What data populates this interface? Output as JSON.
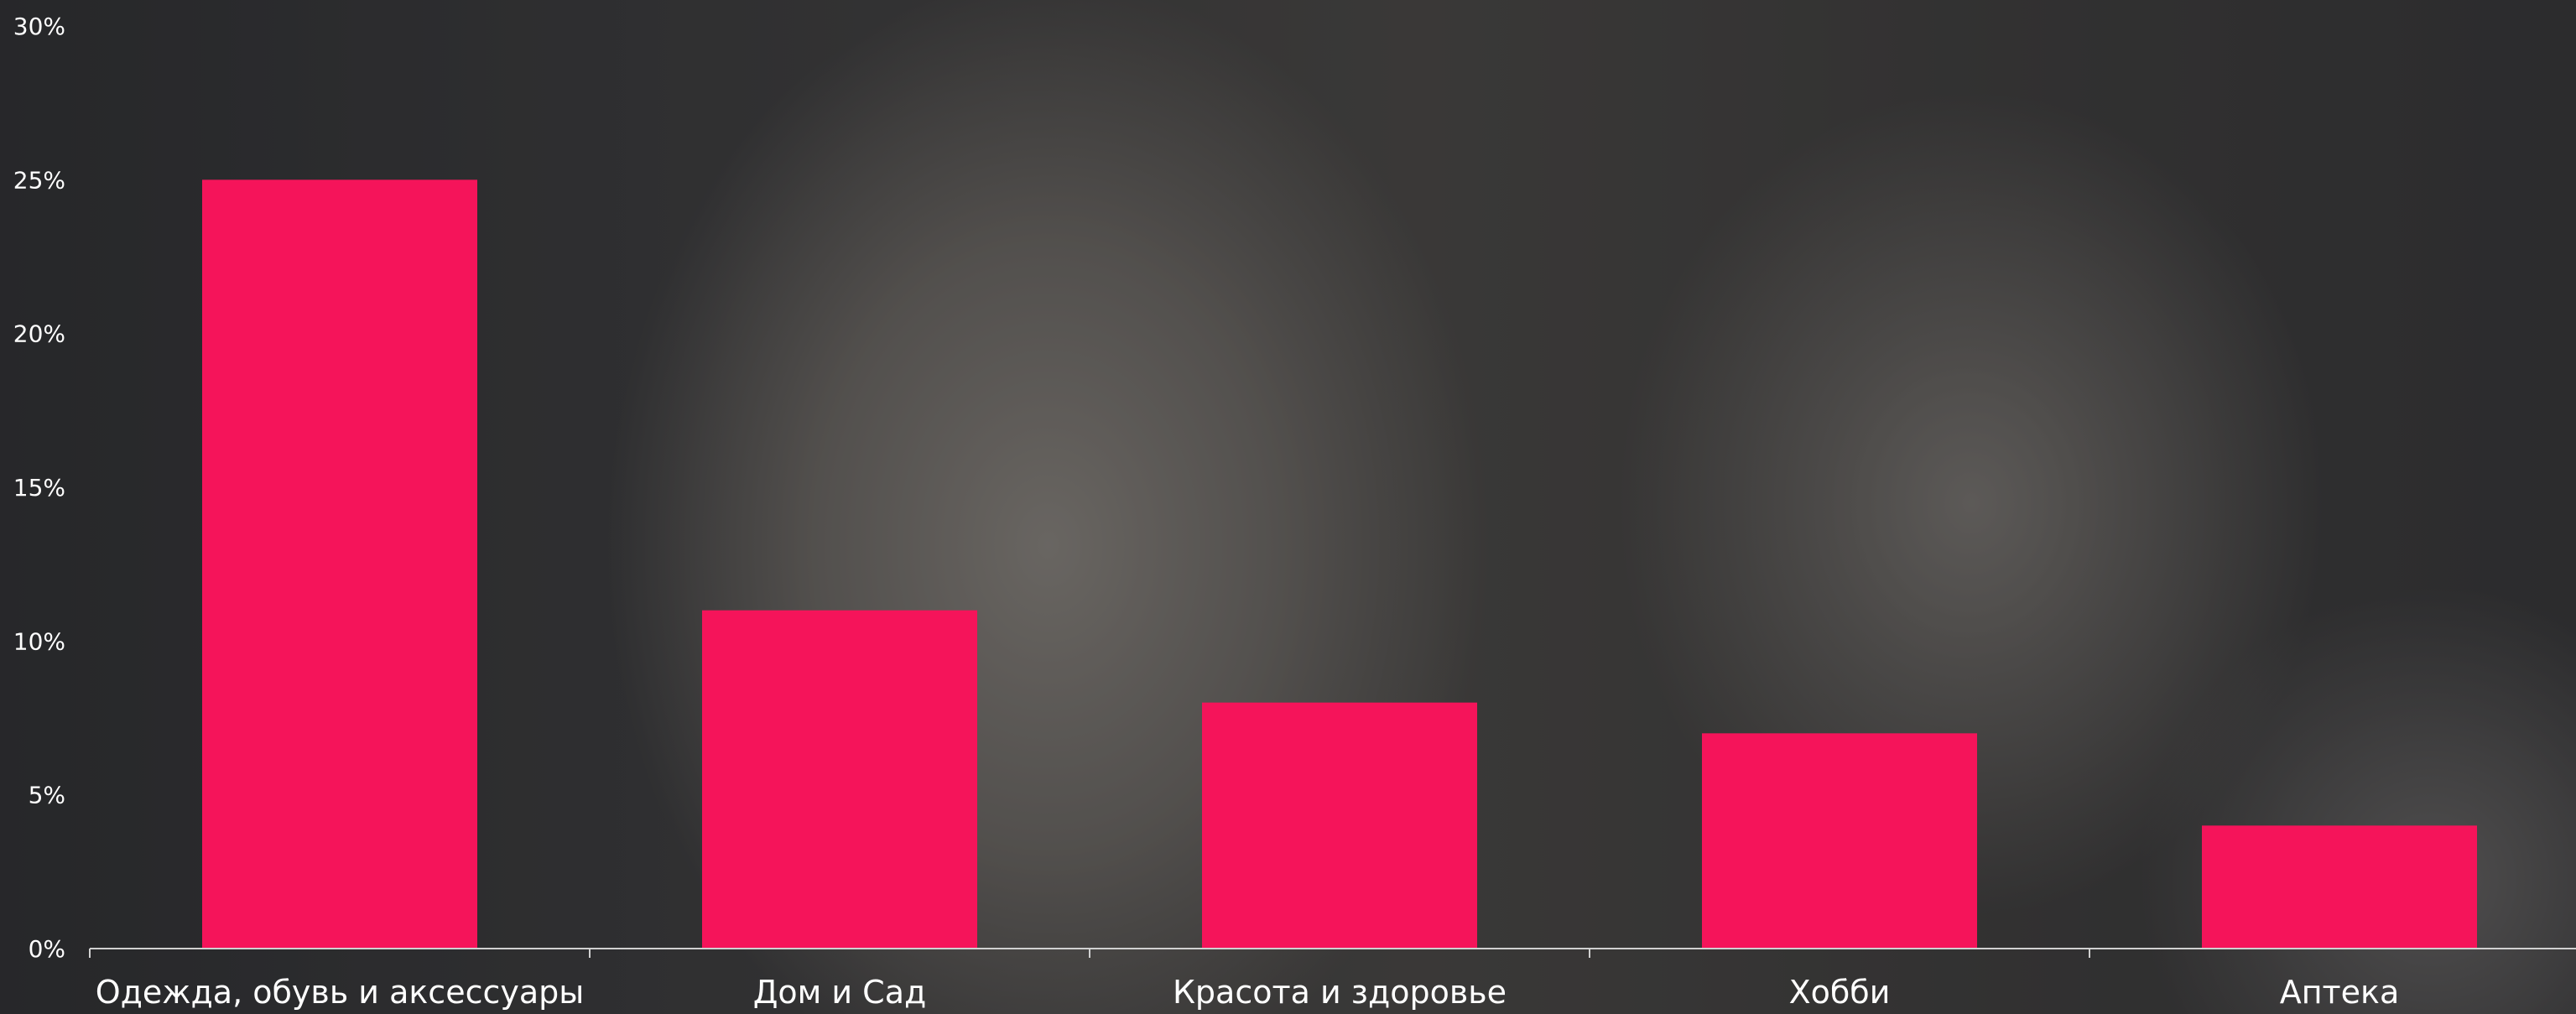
{
  "chart_data": {
    "type": "bar",
    "categories": [
      "Одежда, обувь и аксессуары",
      "Дом и Сад",
      "Красота и здоровье",
      "Хобби",
      "Аптека"
    ],
    "values": [
      25,
      11,
      8,
      7,
      4
    ],
    "ylim": [
      0,
      30
    ],
    "yticks": [
      0,
      5,
      10,
      15,
      20,
      25,
      30
    ],
    "ytick_labels": [
      "0%",
      "5%",
      "10%",
      "15%",
      "20%",
      "25%",
      "30%"
    ],
    "title": "",
    "xlabel": "",
    "ylabel": "",
    "grid": false,
    "legend": "none",
    "colors": {
      "bar": "#f5145a",
      "axis": "#d0d0d0",
      "text": "#ffffff"
    }
  }
}
